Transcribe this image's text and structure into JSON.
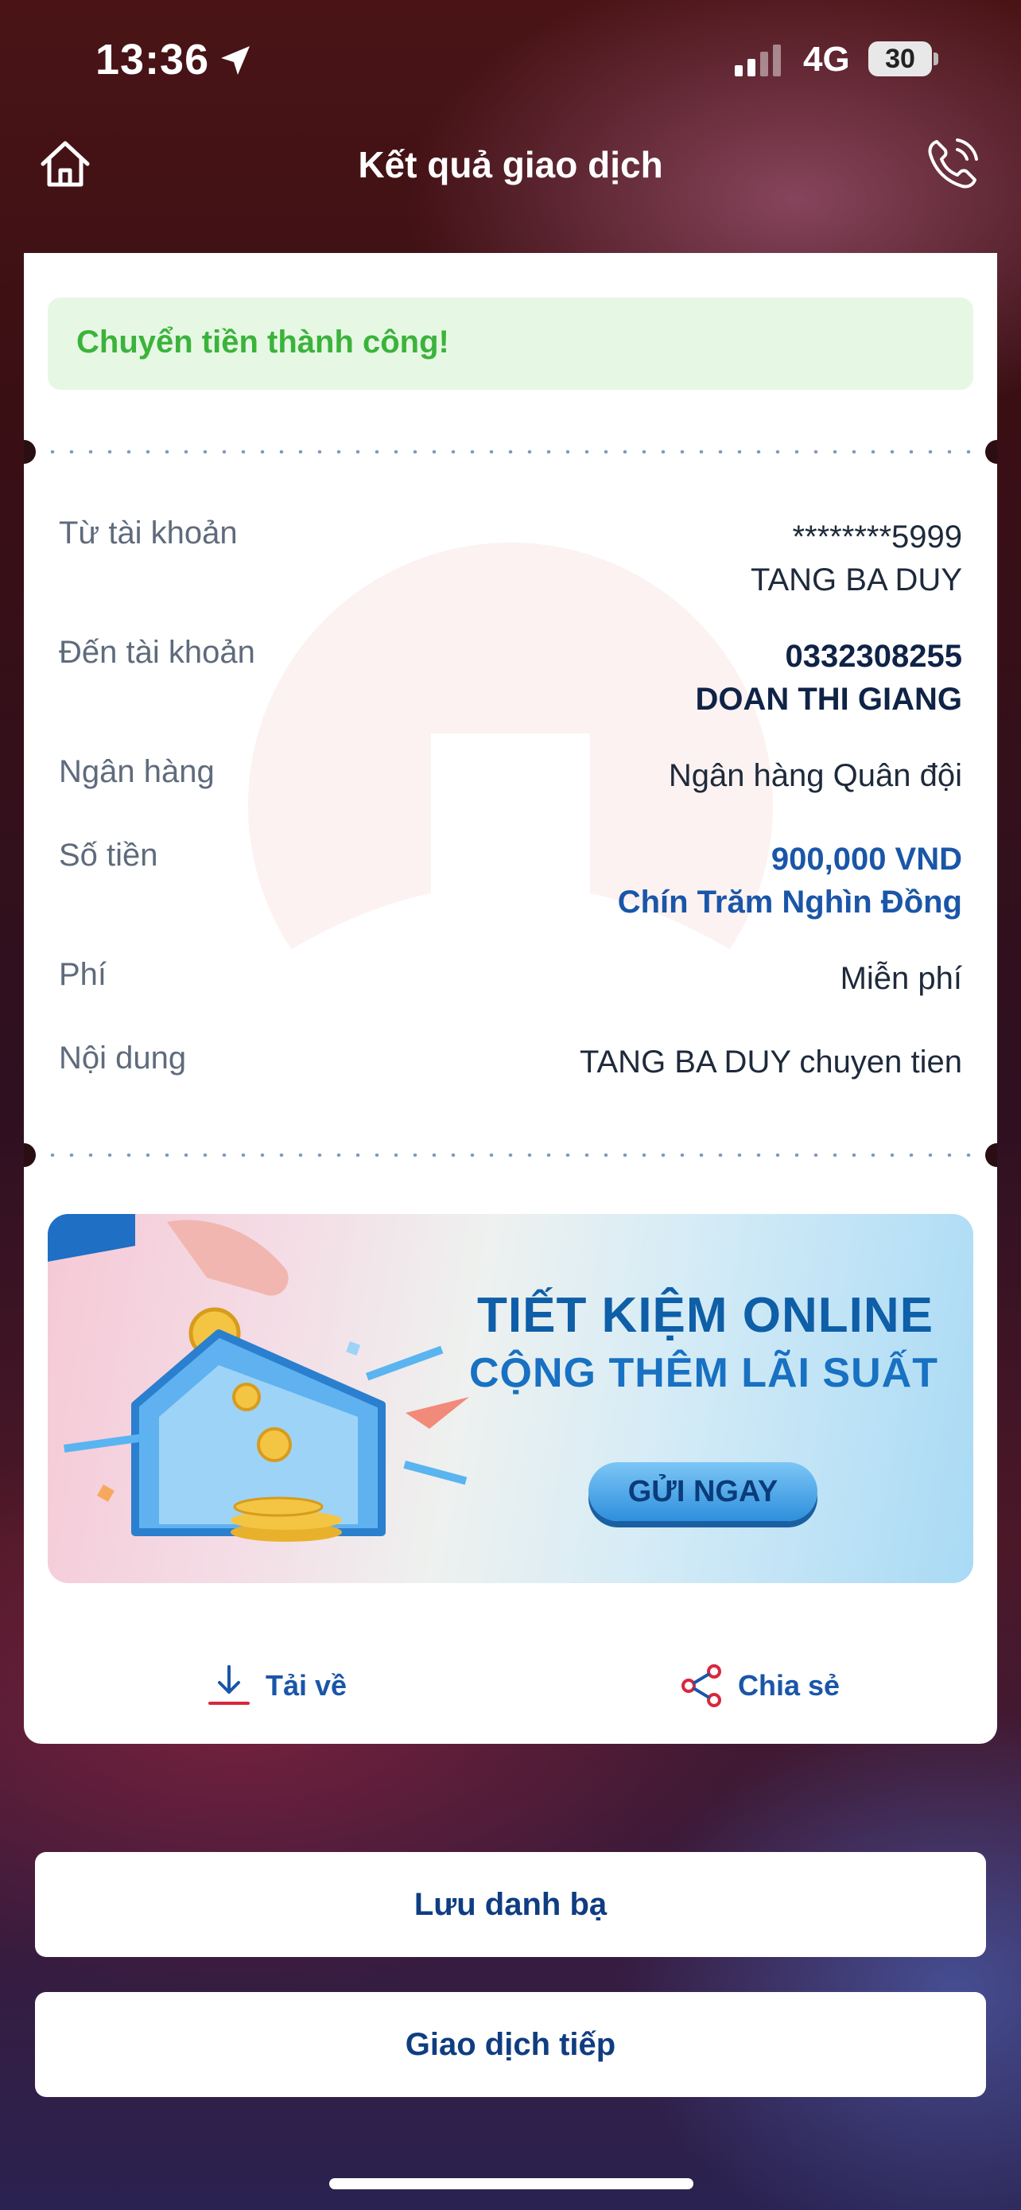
{
  "status_bar": {
    "time": "13:36",
    "network": "4G",
    "battery": "30"
  },
  "header": {
    "title": "Kết quả giao dịch"
  },
  "result": {
    "message": "Chuyển tiền thành công!"
  },
  "details": {
    "from_label": "Từ tài khoản",
    "from_account": "********5999",
    "from_name": "TANG BA DUY",
    "to_label": "Đến tài khoản",
    "to_account": "0332308255",
    "to_name": "DOAN THI GIANG",
    "bank_label": "Ngân hàng",
    "bank_value": "Ngân hàng Quân đội",
    "amount_label": "Số tiền",
    "amount_value": "900,000 VND",
    "amount_words": "Chín Trăm Nghìn Đồng",
    "fee_label": "Phí",
    "fee_value": "Miễn phí",
    "content_label": "Nội dung",
    "content_value": "TANG BA DUY chuyen tien"
  },
  "promo": {
    "line1": "TIẾT KIỆM ONLINE",
    "line2": "CỘNG THÊM LÃI SUẤT",
    "button": "GỬI NGAY"
  },
  "actions": {
    "download": "Tải về",
    "share": "Chia sẻ"
  },
  "buttons": {
    "save_contact": "Lưu danh bạ",
    "next_transaction": "Giao dịch tiếp"
  },
  "colors": {
    "success_green": "#3bb33b",
    "primary_blue": "#1a56a8",
    "navy": "#0f2347",
    "accent_red": "#d8283c"
  }
}
